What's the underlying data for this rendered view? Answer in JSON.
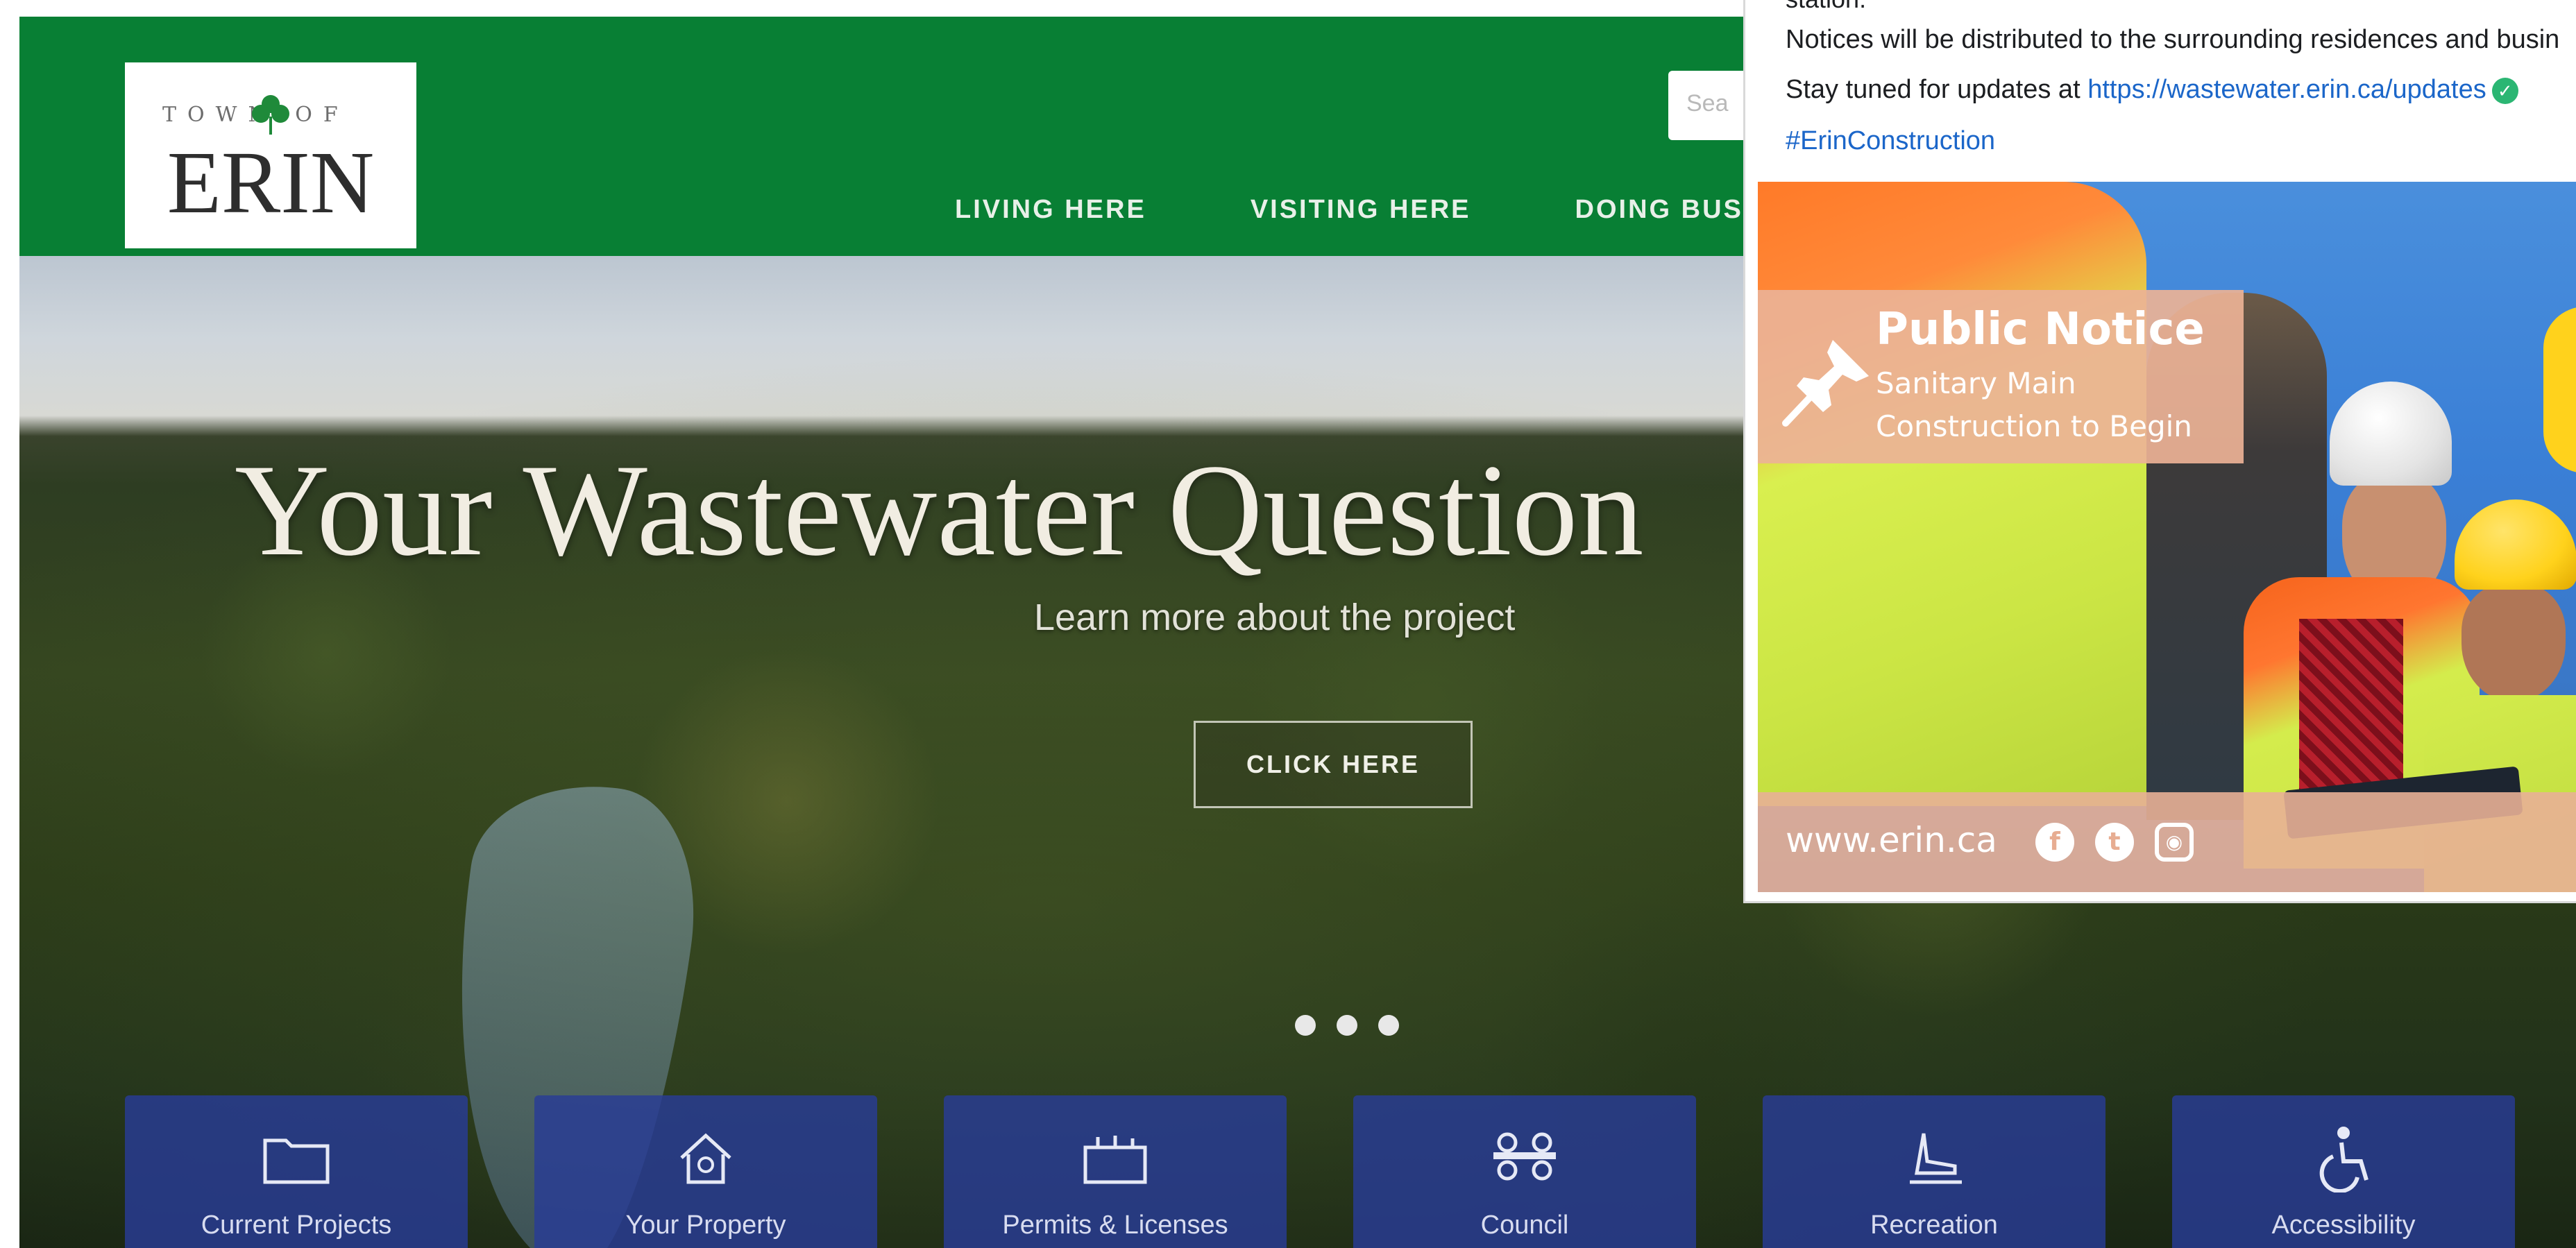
{
  "header": {
    "logo": {
      "top_text": "TOWN OF",
      "name": "ERIN"
    },
    "search_placeholder": "Sea",
    "nav": [
      "LIVING HERE",
      "VISITING HERE",
      "DOING BUS"
    ]
  },
  "hero": {
    "title": "Your Wastewater Question",
    "subtitle": "Learn more about the project",
    "button": "CLICK HERE",
    "slides": 3
  },
  "tiles": [
    {
      "label": "Current Projects",
      "icon": "folder-icon"
    },
    {
      "label": "Your Property",
      "icon": "house-icon"
    },
    {
      "label": "Permits & Licenses",
      "icon": "permit-icon"
    },
    {
      "label": "Council",
      "icon": "council-icon"
    },
    {
      "label": "Recreation",
      "icon": "skate-icon"
    },
    {
      "label": "Accessibility",
      "icon": "accessibility-icon"
    }
  ],
  "post": {
    "cut_text": "station.",
    "line1": "Notices will be distributed to the surrounding residences  and busin",
    "line2_prefix": "Stay tuned for updates at ",
    "line2_link": "https://wastewater.erin.ca/updates",
    "hashtag": "#ErinConstruction",
    "image": {
      "notice_title": "Public Notice",
      "notice_line1": "Sanitary Main",
      "notice_line2": "Construction to Begin",
      "footer_url": "www.erin.ca",
      "social": [
        "facebook-icon",
        "twitter-icon",
        "instagram-icon"
      ]
    }
  },
  "colors": {
    "header_green": "#087f34",
    "tile_blue": "#283c96",
    "link_blue": "#1b66c9",
    "notice_peach": "#ecb296"
  }
}
